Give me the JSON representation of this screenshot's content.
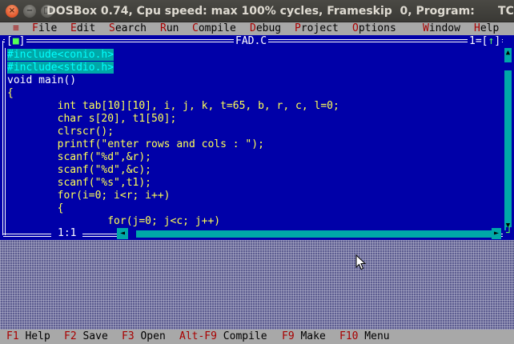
{
  "window": {
    "title": "DOSBox 0.74, Cpu speed: max 100% cycles, Frameskip  0, Program:      TC"
  },
  "menubar": {
    "system_label": "≡",
    "items": [
      {
        "hot": "F",
        "rest": "ile"
      },
      {
        "hot": "E",
        "rest": "dit"
      },
      {
        "hot": "S",
        "rest": "earch"
      },
      {
        "hot": "R",
        "rest": "un"
      },
      {
        "hot": "C",
        "rest": "ompile"
      },
      {
        "hot": "D",
        "rest": "ebug"
      },
      {
        "hot": "P",
        "rest": "roject"
      },
      {
        "hot": "O",
        "rest": "ptions"
      },
      {
        "hot": "W",
        "rest": "indow"
      },
      {
        "hot": "H",
        "rest": "elp"
      }
    ]
  },
  "editor": {
    "close_box_left": "[",
    "close_box_mark": "■",
    "close_box_right": "]",
    "file_name": "FAD.C",
    "window_number": "1=[",
    "window_zoom": "↑",
    "window_number_end": "]",
    "cursor_position": "1:1",
    "code_lines": [
      "#include<conio.h>",
      "#include<stdio.h>",
      "void main()",
      "{",
      "        int tab[10][10], i, j, k, t=65, b, r, c, l=0;",
      "        char s[20], t1[50];",
      "        clrscr();",
      "        printf(\"enter rows and cols : \");",
      "        scanf(\"%d\",&r);",
      "        scanf(\"%d\",&c);",
      "        scanf(\"%s\",t1);",
      "        for(i=0; i<r; i++)",
      "        {",
      "                for(j=0; j<c; j++)"
    ]
  },
  "hotkeys": [
    {
      "key": "F1",
      "label": " Help"
    },
    {
      "key": "F2",
      "label": " Save"
    },
    {
      "key": "F3",
      "label": " Open"
    },
    {
      "key": "Alt-F9",
      "label": " Compile"
    },
    {
      "key": "F9",
      "label": " Make"
    },
    {
      "key": "F10",
      "label": " Menu"
    }
  ],
  "colors": {
    "editor_bg": "#0000a8",
    "menu_bg": "#a8a8a8",
    "hotkey_red": "#a80000",
    "preprocessor_bg": "#00a8a8",
    "identifier_yellow": "#ffff55",
    "string_red": "#ff5555"
  }
}
